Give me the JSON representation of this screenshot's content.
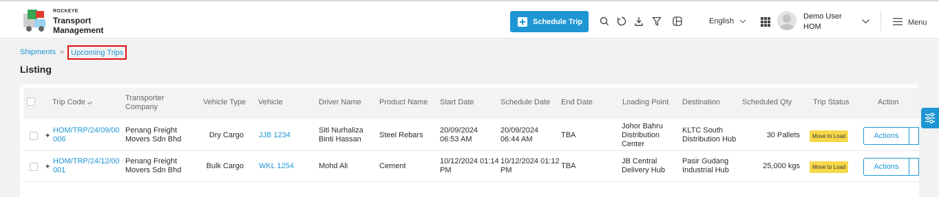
{
  "brand": {
    "company": "ROCKEYE",
    "product_line1": "Transport",
    "product_line2": "Management"
  },
  "header": {
    "schedule_button_label": "Schedule Trip",
    "language": "English",
    "user_name": "Demo User",
    "user_org": "HOM",
    "menu_label": "Menu",
    "icons": [
      "search-icon",
      "refresh-icon",
      "download-icon",
      "filter-icon",
      "layout-icon",
      "apps-grid-icon"
    ]
  },
  "breadcrumb": {
    "parent": "Shipments",
    "separator": "»",
    "current": "Upcoming Trips"
  },
  "page": {
    "title": "Listing"
  },
  "table": {
    "columns": {
      "trip_code": "Trip Code",
      "transporter_company": "Transporter Company",
      "vehicle_type": "Vehicle Type",
      "vehicle": "Vehicle",
      "driver_name": "Driver Name",
      "product_name": "Product Name",
      "start_date": "Start Date",
      "schedule_date": "Schedule Date",
      "end_date": "End Date",
      "loading_point": "Loading Point",
      "destination": "Destination",
      "scheduled_qty": "Scheduled Qty",
      "trip_status": "Trip Status",
      "action": "Action"
    },
    "sort_indicator": "▴▾",
    "expand_symbol": "+",
    "rows": [
      {
        "trip_code_l1": "HOM/TRP/24/09/00",
        "trip_code_l2": "006",
        "company_l1": "Penang Freight",
        "company_l2": "Movers Sdn Bhd",
        "vehicle_type": "Dry Cargo",
        "vehicle": "JJB 1234",
        "driver_l1": "Siti Nurhaliza",
        "driver_l2": "Binti Hassan",
        "product": "Steel Rebars",
        "start_l1": "20/09/2024",
        "start_l2": "06:53 AM",
        "schedule_l1": "20/09/2024",
        "schedule_l2": "06:44 AM",
        "end_date": "TBA",
        "loading_l1": "Johor Bahru",
        "loading_l2": "Distribution",
        "loading_l3": "Center",
        "dest_l1": "KLTC South",
        "dest_l2": "Distribution Hub",
        "qty": "30 Pallets",
        "status": "Move to Load",
        "action_label": "Actions"
      },
      {
        "trip_code_l1": "HOM/TRP/24/12/00",
        "trip_code_l2": "001",
        "company_l1": "Penang Freight",
        "company_l2": "Movers Sdn Bhd",
        "vehicle_type": "Bulk Cargo",
        "vehicle": "WKL 1254",
        "driver_l1": "Mohd Ali",
        "driver_l2": "",
        "product": "Cement",
        "start_l1": "10/12/2024 01:14",
        "start_l2": "PM",
        "schedule_l1": "10/12/2024 01:12",
        "schedule_l2": "PM",
        "end_date": "TBA",
        "loading_l1": "JB Central",
        "loading_l2": "Delivery Hub",
        "loading_l3": "",
        "dest_l1": "Pasir Gudang",
        "dest_l2": "Industrial Hub",
        "qty": "25,000 kgs",
        "status": "Move to Load",
        "action_label": "Actions"
      }
    ]
  },
  "colors": {
    "accent": "#1e96d3",
    "status_badge": "#f7d84a",
    "highlight_box": "#e01010"
  }
}
